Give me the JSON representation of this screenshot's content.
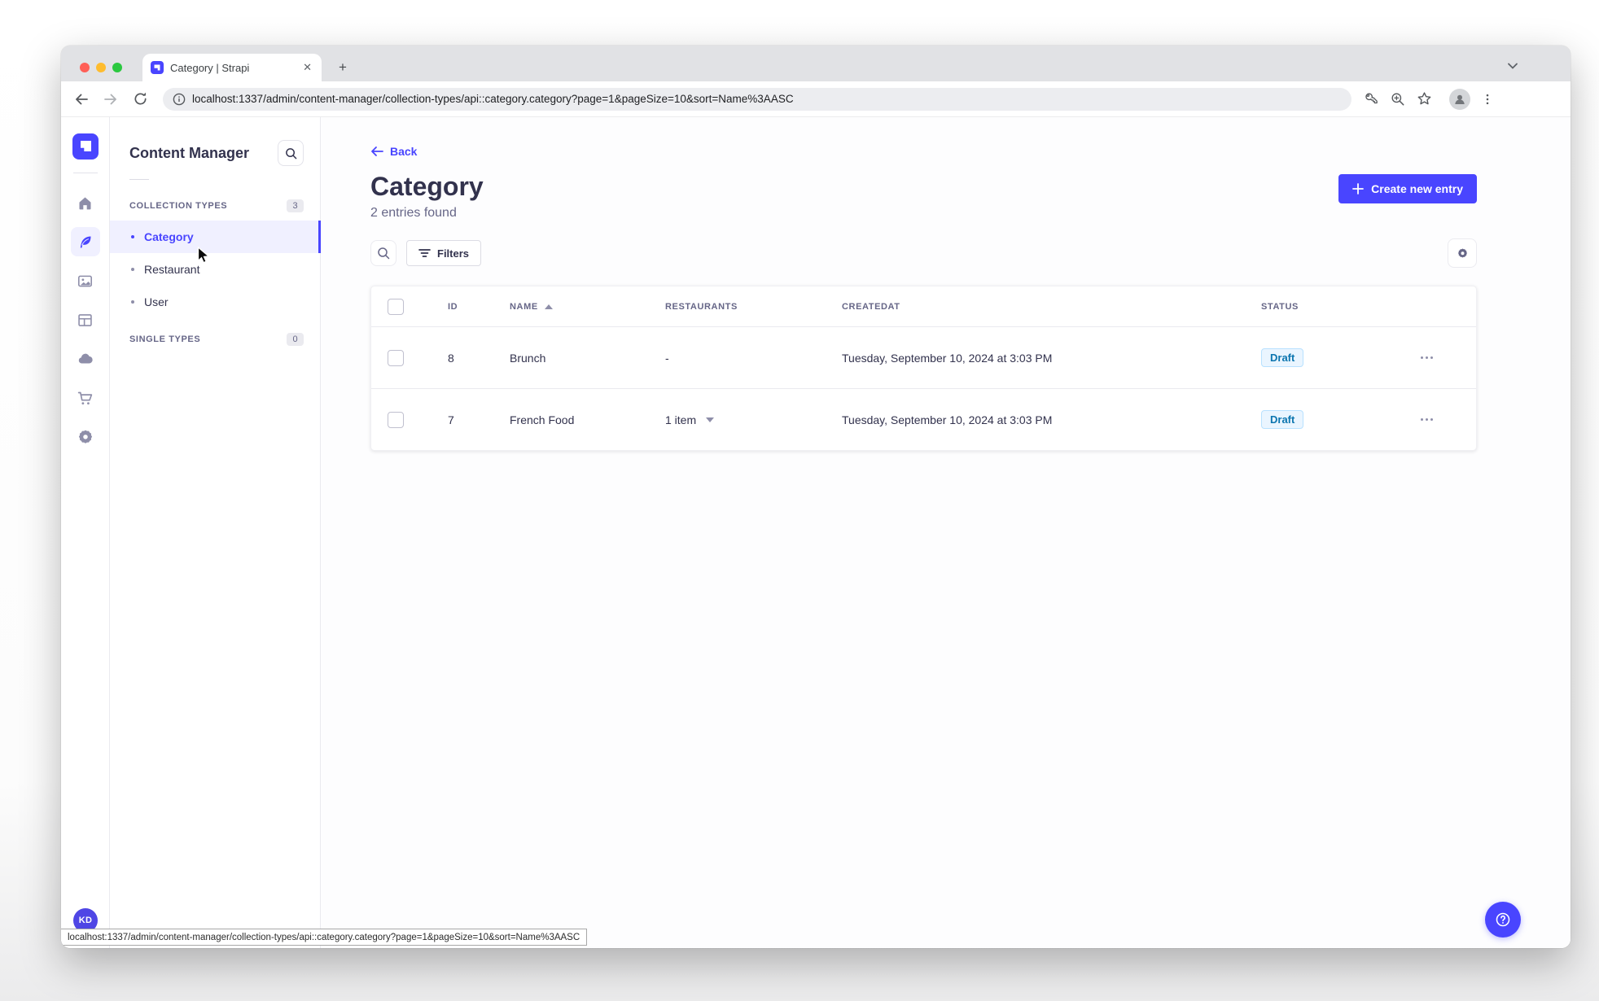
{
  "colors": {
    "primary": "#4945ff",
    "draft_bg": "#eaf5ff",
    "draft_border": "#b8e1ff",
    "draft_text": "#0c75af"
  },
  "browser": {
    "tab_title": "Category | Strapi",
    "new_tab_label": "+",
    "url": "localhost:1337/admin/content-manager/collection-types/api::category.category?page=1&pageSize=10&sort=Name%3AASC",
    "status_url": "localhost:1337/admin/content-manager/collection-types/api::category.category?page=1&pageSize=10&sort=Name%3AASC"
  },
  "rail": {
    "icons": [
      "strapi-logo",
      "home-icon",
      "content-manager-feather-icon",
      "media-library-icon",
      "content-type-builder-icon",
      "cloud-icon",
      "marketplace-cart-icon",
      "settings-gear-icon"
    ],
    "avatar_initials": "KD"
  },
  "panel": {
    "title": "Content Manager",
    "sections": [
      {
        "label": "COLLECTION TYPES",
        "count": "3",
        "items": [
          {
            "label": "Category"
          },
          {
            "label": "Restaurant"
          },
          {
            "label": "User"
          }
        ]
      },
      {
        "label": "SINGLE TYPES",
        "count": "0",
        "items": []
      }
    ]
  },
  "main": {
    "back_label": "Back",
    "title": "Category",
    "subtitle": "2 entries found",
    "create_button_label": "Create new entry",
    "filters_button_label": "Filters",
    "table": {
      "columns": [
        "ID",
        "NAME",
        "RESTAURANTS",
        "CREATEDAT",
        "STATUS"
      ],
      "rows": [
        {
          "id": "8",
          "name": "Brunch",
          "restaurants": "-",
          "created_at": "Tuesday, September 10, 2024 at 3:03 PM",
          "status": "Draft"
        },
        {
          "id": "7",
          "name": "French Food",
          "restaurants": "1 item",
          "created_at": "Tuesday, September 10, 2024 at 3:03 PM",
          "status": "Draft"
        }
      ]
    }
  }
}
